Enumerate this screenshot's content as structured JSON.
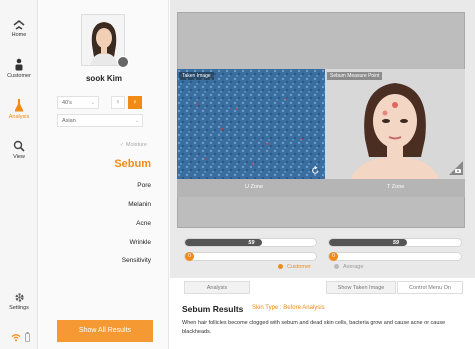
{
  "nav": {
    "items": [
      {
        "label": "Home",
        "icon": "home-icon"
      },
      {
        "label": "Customer",
        "icon": "customer-icon"
      },
      {
        "label": "Analysis",
        "icon": "analysis-icon",
        "active": true
      },
      {
        "label": "View",
        "icon": "view-icon"
      },
      {
        "label": "Settings",
        "icon": "settings-icon"
      }
    ]
  },
  "profile": {
    "name": "sook Kim",
    "age_group": "40's",
    "ethnicity": "Asian"
  },
  "menu": {
    "moisture": "Moisture",
    "items": [
      "Sebum",
      "Pore",
      "Melanin",
      "Acne",
      "Wrinkle",
      "Sensitivity"
    ],
    "active": "Sebum",
    "show_all": "Show All Results"
  },
  "images": {
    "left_label": "Taken Image",
    "right_label": "Sebum Measure Point",
    "left_zone": "U Zone",
    "right_zone": "T Zone"
  },
  "bars": {
    "u_zone": {
      "customer": 59,
      "average": 0,
      "range_max": 100
    },
    "t_zone": {
      "customer": 59,
      "average": 0,
      "range_max": 100
    }
  },
  "legend": {
    "customer": "Customer",
    "average": "Average"
  },
  "buttons": {
    "analysis": "Analysis",
    "show_taken_image": "Show Taken Image",
    "control_menu": "Control Menu On"
  },
  "result": {
    "title": "Sebum Results",
    "subtitle": "Skin Type : Before Analysis",
    "description": "When hair follicles become clogged with sebum and dead skin cells, bacteria grow and cause acne or cause blackheads."
  },
  "colors": {
    "accent": "#f28a16",
    "bar_customer": "#555555"
  }
}
